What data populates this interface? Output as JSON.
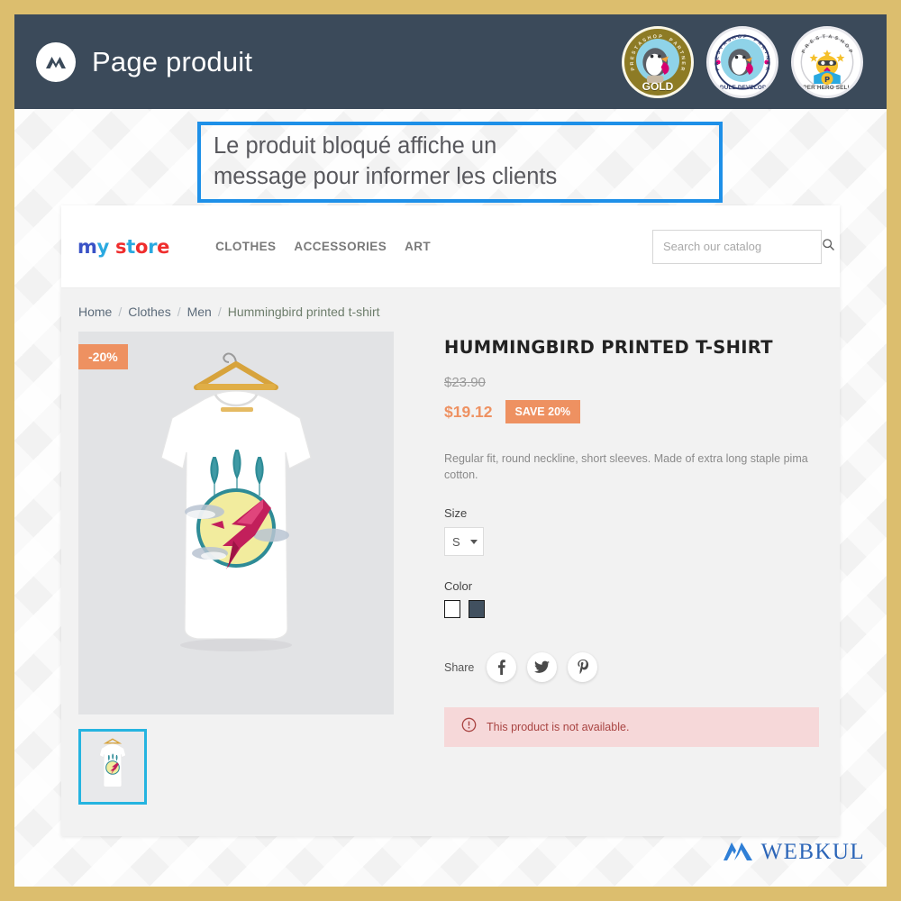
{
  "appbar": {
    "title": "Page produit",
    "logo_icon": "webkul-w-mark-icon",
    "badges": [
      {
        "name": "prestashop-partner-gold-badge",
        "ring_text": "PRESTASHOP PARTNER",
        "bottom_text": "GOLD"
      },
      {
        "name": "prestashop-partner-module-developer-badge",
        "ring_text": "PRESTASHOP PARTNER",
        "bottom_text": "MODULE DEVELOPER"
      },
      {
        "name": "prestashop-super-hero-seller-badge",
        "ring_text": "PRESTASHOP",
        "bottom_text": "SUPER HERO SELLER"
      }
    ]
  },
  "callout": {
    "line1": "Le produit bloqué affiche un",
    "line2": "message pour informer les clients",
    "border_color": "#1e90e8",
    "text_color": "#58585d"
  },
  "shop": {
    "logo": {
      "part1": "m",
      "part2": "y",
      "part3": "s",
      "part4": "t",
      "part5": "o",
      "part6": "r",
      "part7": "e"
    },
    "nav": [
      {
        "label": "CLOTHES",
        "name": "nav-clothes"
      },
      {
        "label": "ACCESSORIES",
        "name": "nav-accessories"
      },
      {
        "label": "ART",
        "name": "nav-art"
      }
    ],
    "search": {
      "placeholder": "Search our catalog",
      "value": "",
      "icon": "search-icon"
    },
    "breadcrumb": [
      {
        "label": "Home",
        "current": false
      },
      {
        "label": "Clothes",
        "current": false
      },
      {
        "label": "Men",
        "current": false
      },
      {
        "label": "Hummingbird printed t-shirt",
        "current": true
      }
    ],
    "breadcrumb_separator": "/"
  },
  "product": {
    "title": "HUMMINGBIRD PRINTED T-SHIRT",
    "discount_flag": "-20%",
    "price_old": "$23.90",
    "price_now": "$19.12",
    "save_badge": "SAVE 20%",
    "short_description": "Regular fit, round neckline, short sleeves. Made of extra long staple pima cotton.",
    "size": {
      "label": "Size",
      "value": "S"
    },
    "color": {
      "label": "Color",
      "swatches": [
        {
          "name": "color-swatch-white",
          "hex": "#ffffff"
        },
        {
          "name": "color-swatch-dark",
          "hex": "#41505f"
        }
      ]
    },
    "share": {
      "label": "Share",
      "buttons": [
        {
          "name": "share-facebook-button",
          "icon": "facebook-icon"
        },
        {
          "name": "share-twitter-button",
          "icon": "twitter-icon"
        },
        {
          "name": "share-pinterest-button",
          "icon": "pinterest-icon"
        }
      ]
    },
    "alert": {
      "text": "This product is not available.",
      "icon": "exclamation-circle-icon",
      "bg_color": "#f6d8d9",
      "text_color": "#a94442"
    },
    "accent_color": "#ee9161",
    "thumbnail_border_color": "#25b4e0"
  },
  "footer": {
    "webkul_text": "WEBKUL",
    "webkul_icon": "webkul-mountain-logo-icon"
  }
}
